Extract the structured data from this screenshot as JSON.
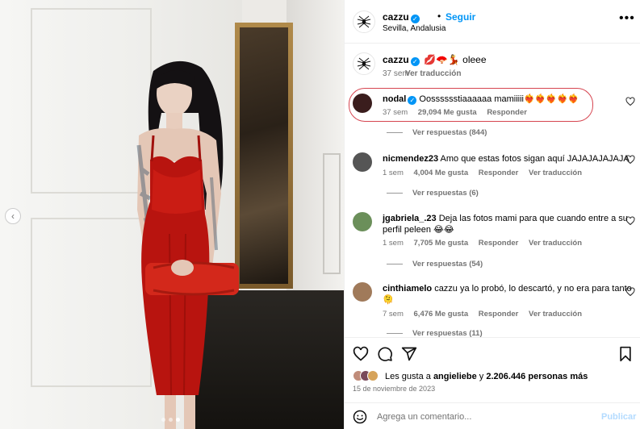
{
  "post": {
    "username": "cazzu",
    "verified_mark": "✓",
    "separator": "•",
    "follow_label": "Seguir",
    "location": "Sevilla, Andalusia",
    "more_icon": "more-options-icon",
    "more_label": "•••"
  },
  "caption": {
    "username": "cazzu",
    "text": "💋🪭💃 oleee",
    "time": "37 sem",
    "translate": "Ver traducción"
  },
  "comments": [
    {
      "username": "nodal",
      "verified": true,
      "text": "Oosssssstiaaaaaa mamiiiii❤️‍🔥❤️‍🔥❤️‍🔥❤️‍🔥❤️‍🔥",
      "time": "37 sem",
      "likes": "29,094 Me gusta",
      "reply": "Responder",
      "translate": "",
      "replies": "Ver respuestas (844)",
      "avatar_color": "#3a1d1d"
    },
    {
      "username": "nicmendez23",
      "verified": false,
      "text": "Amo que estas fotos sigan aquí JAJAJAJAJAJA",
      "time": "1 sem",
      "likes": "4,004 Me gusta",
      "reply": "Responder",
      "translate": "Ver traducción",
      "replies": "Ver respuestas (6)",
      "avatar_color": "#555555"
    },
    {
      "username": "jgabriela_.23",
      "verified": false,
      "text": "Deja las fotos mami para que cuando entre a su",
      "text2": "perfil peleen 😂😂",
      "time": "1 sem",
      "likes": "7,705 Me gusta",
      "reply": "Responder",
      "translate": "Ver traducción",
      "replies": "Ver respuestas (54)",
      "avatar_color": "#6b8f5a"
    },
    {
      "username": "cinthiamelo",
      "verified": false,
      "text": "cazzu ya lo probó, lo descartó, y no era para tanto",
      "text2": "🫠",
      "time": "7 sem",
      "likes": "6,476 Me gusta",
      "reply": "Responder",
      "translate": "Ver traducción",
      "replies": "Ver respuestas (11)",
      "avatar_color": "#a07a5a"
    }
  ],
  "actions": {
    "like_icon": "heart-icon",
    "comment_icon": "comment-icon",
    "share_icon": "share-icon",
    "save_icon": "bookmark-icon"
  },
  "likes": {
    "prefix": "Les gusta a ",
    "user": "angieliebe",
    "middle": " y ",
    "count": "2.206.446 personas más"
  },
  "date": "15 de noviembre de 2023",
  "add_comment": {
    "placeholder": "Agrega un comentario...",
    "publish_label": "Publicar"
  },
  "colors": {
    "accent": "#0095f6",
    "highlight_circle": "#d64550",
    "muted": "#737373"
  },
  "carousel": {
    "nav_prev": "‹"
  }
}
